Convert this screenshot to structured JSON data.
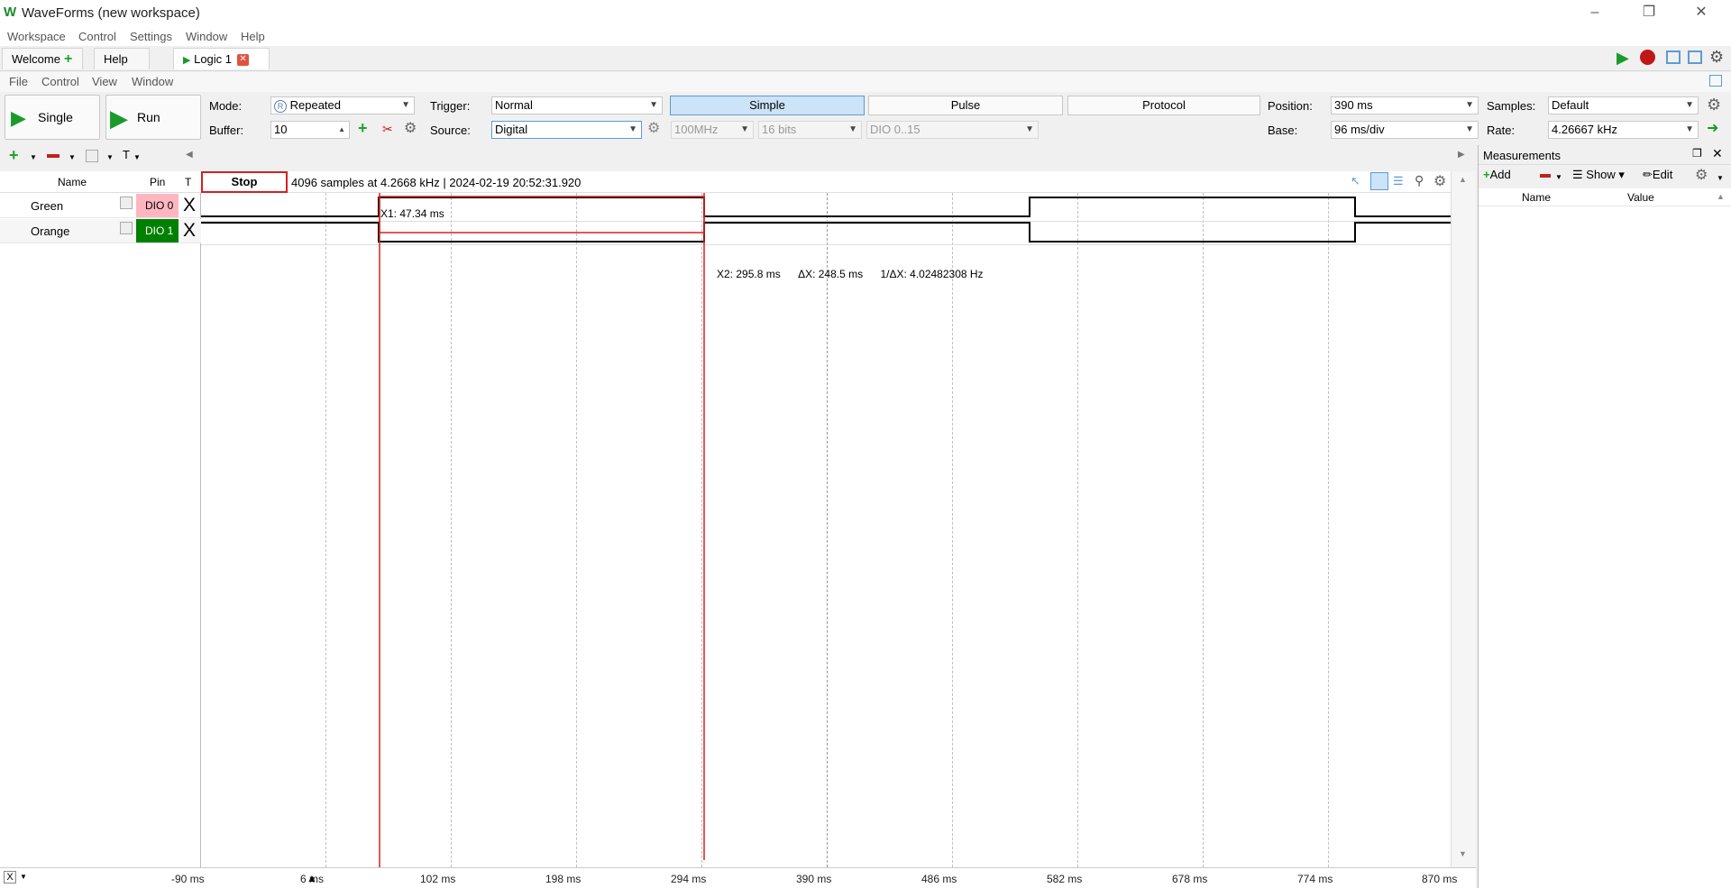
{
  "app": {
    "title": "WaveForms (new workspace)"
  },
  "menu": [
    "Workspace",
    "Control",
    "Settings",
    "Window",
    "Help"
  ],
  "tabs": {
    "welcome": "Welcome",
    "help": "Help",
    "logic": "Logic 1"
  },
  "submenu": [
    "File",
    "Control",
    "View",
    "Window"
  ],
  "control": {
    "single": "Single",
    "run": "Run",
    "mode_label": "Mode:",
    "mode_value": "Repeated",
    "buffer_label": "Buffer:",
    "buffer_value": "10",
    "trigger_label": "Trigger:",
    "trigger_value": "Normal",
    "source_label": "Source:",
    "source_value": "Digital",
    "freq_value": "100MHz",
    "bits_value": "16 bits",
    "dio_value": "DIO 0..15",
    "simple": "Simple",
    "pulse": "Pulse",
    "protocol": "Protocol",
    "position_label": "Position:",
    "position_value": "390 ms",
    "base_label": "Base:",
    "base_value": "96 ms/div",
    "samples_label": "Samples:",
    "samples_value": "Default",
    "rate_label": "Rate:",
    "rate_value": "4.26667 kHz"
  },
  "channels": {
    "headers": {
      "name": "Name",
      "pin": "Pin",
      "t": "T"
    },
    "rows": [
      {
        "name": "Green",
        "pin": "DIO 0",
        "t": "X",
        "pin_color": "#ffb6c1",
        "text_color": "#000000"
      },
      {
        "name": "Orange",
        "pin": "DIO 1",
        "t": "X",
        "pin_color": "#008000",
        "text_color": "#ffffff"
      }
    ]
  },
  "status": {
    "stop": "Stop",
    "info": "4096 samples at 4.2668 kHz | 2024-02-19 20:52:31.920"
  },
  "cursors": {
    "x1": "X1: 47.34 ms",
    "x2": "X2: 295.8 ms",
    "dx": "ΔX: 248.5 ms",
    "inv_dx": "1/ΔX: 4.02482308 Hz"
  },
  "xaxis": [
    "-90 ms",
    "6 ms",
    "102 ms",
    "198 ms",
    "294 ms",
    "390 ms",
    "486 ms",
    "582 ms",
    "678 ms",
    "774 ms",
    "870 ms"
  ],
  "measurements": {
    "title": "Measurements",
    "add": "Add",
    "show": "Show",
    "edit": "Edit",
    "col_name": "Name",
    "col_value": "Value"
  },
  "colors": {
    "cursor": "#d42020",
    "accent": "#5b9bd5",
    "run_green": "#1a9a2a"
  }
}
